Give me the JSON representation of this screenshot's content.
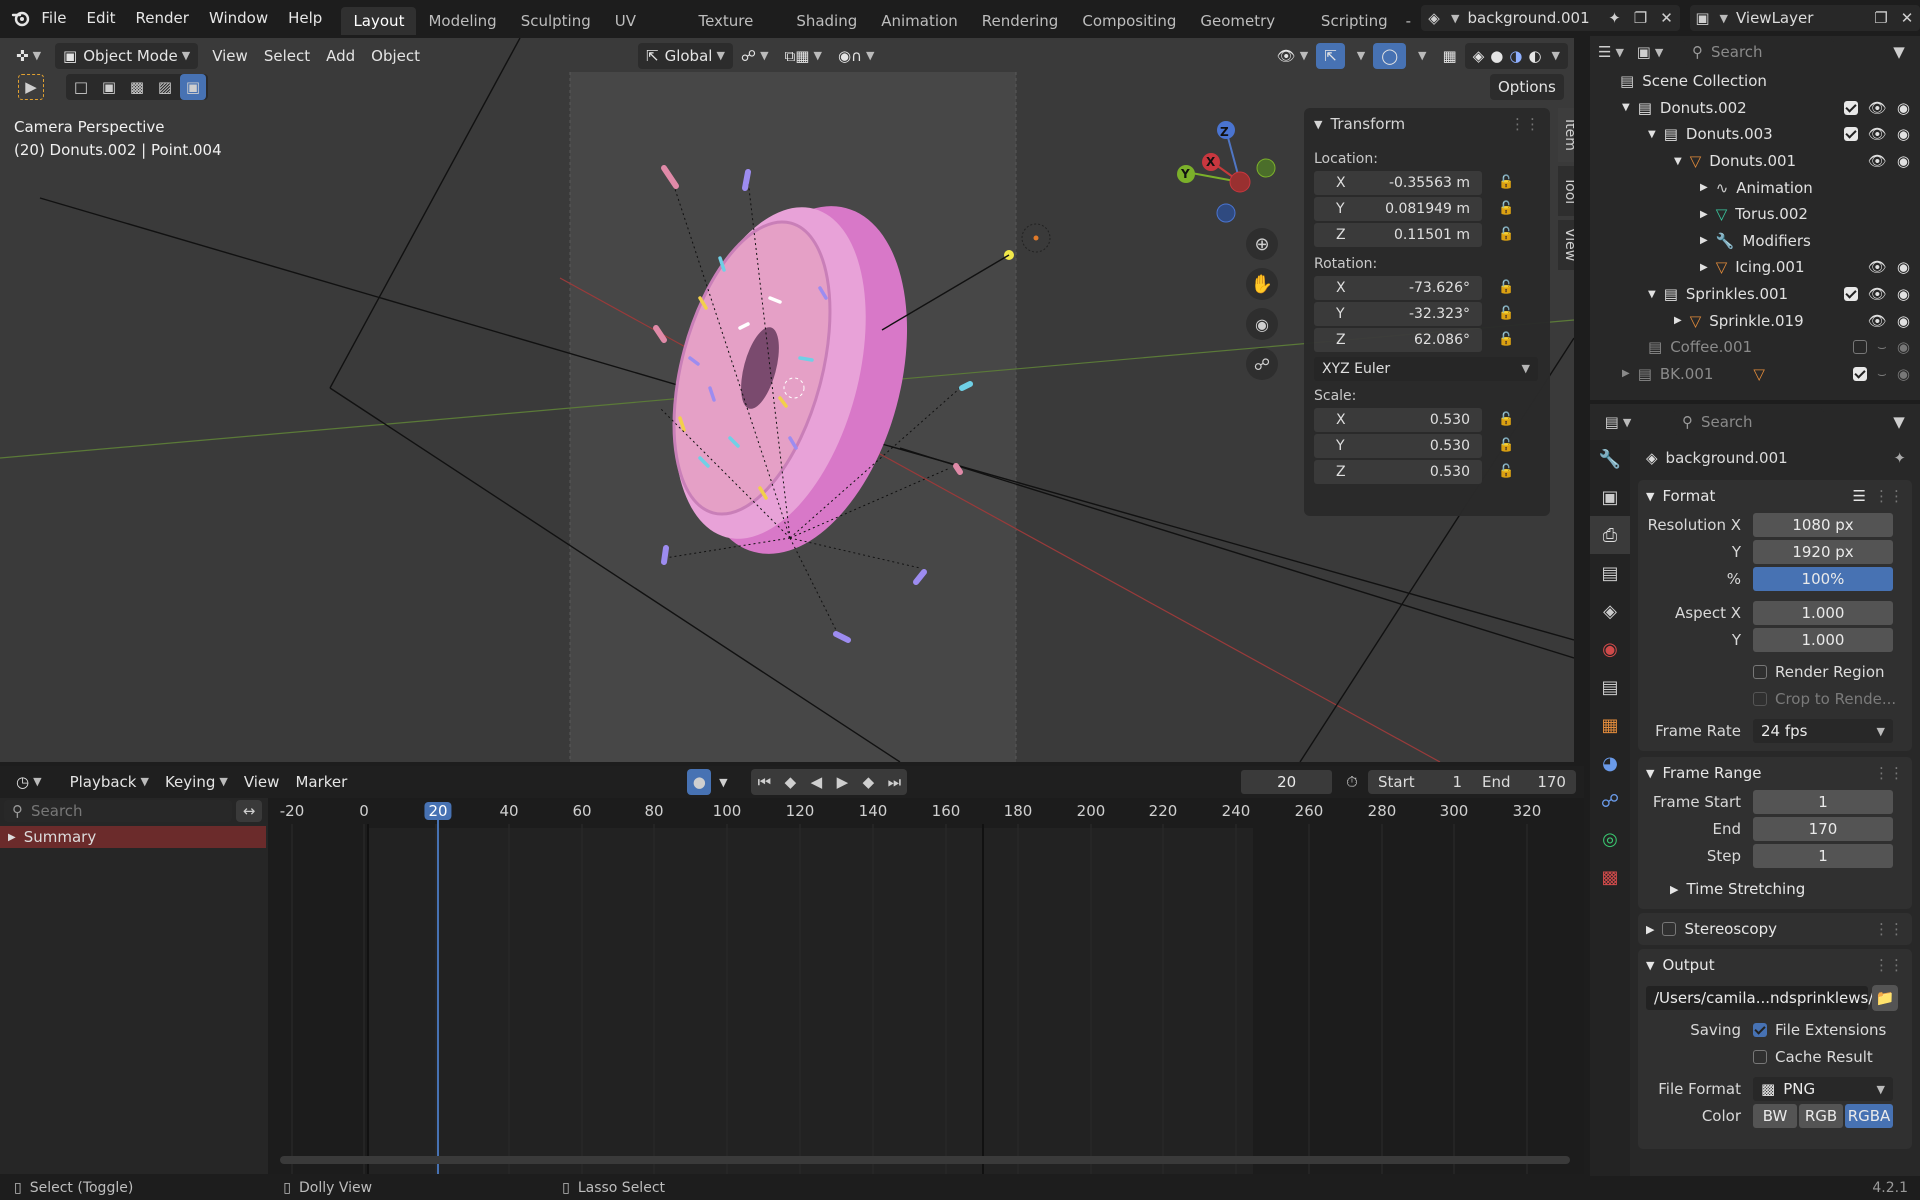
{
  "topbar": {
    "menus": [
      "File",
      "Edit",
      "Render",
      "Window",
      "Help"
    ],
    "workspaces": [
      "Layout",
      "Modeling",
      "Sculpting",
      "UV Editing",
      "Texture Paint",
      "Shading",
      "Animation",
      "Rendering",
      "Compositing",
      "Geometry Nodes",
      "Scripting"
    ],
    "active_workspace": "Layout",
    "more": "-",
    "scene_name": "background.001",
    "view_layer": "ViewLayer"
  },
  "viewport": {
    "mode": "Object Mode",
    "menus": [
      "View",
      "Select",
      "Add",
      "Object"
    ],
    "orientation": "Global",
    "options": "Options",
    "overlay_title": "Camera Perspective",
    "overlay_subtitle": "(20) Donuts.002 | Point.004",
    "sidetabs": [
      "Item",
      "Tool",
      "View"
    ],
    "gizmo": {
      "z": "Z",
      "y": "Y",
      "x": "X"
    }
  },
  "transform": {
    "title": "Transform",
    "location_label": "Location:",
    "location": [
      {
        "axis": "X",
        "value": "-0.35563 m"
      },
      {
        "axis": "Y",
        "value": "0.081949 m"
      },
      {
        "axis": "Z",
        "value": "0.11501 m"
      }
    ],
    "rotation_label": "Rotation:",
    "rotation": [
      {
        "axis": "X",
        "value": "-73.626°"
      },
      {
        "axis": "Y",
        "value": "-32.323°"
      },
      {
        "axis": "Z",
        "value": "62.086°"
      }
    ],
    "rotation_mode": "XYZ Euler",
    "scale_label": "Scale:",
    "scale": [
      {
        "axis": "X",
        "value": "0.530"
      },
      {
        "axis": "Y",
        "value": "0.530"
      },
      {
        "axis": "Z",
        "value": "0.530"
      }
    ]
  },
  "outliner": {
    "search_placeholder": "Search",
    "items": [
      {
        "label": "Scene Collection"
      },
      {
        "label": "Donuts.002"
      },
      {
        "label": "Donuts.003"
      },
      {
        "label": "Donuts.001"
      },
      {
        "label": "Animation"
      },
      {
        "label": "Torus.002"
      },
      {
        "label": "Modifiers"
      },
      {
        "label": "Icing.001"
      },
      {
        "label": "Sprinkles.001"
      },
      {
        "label": "Sprinkle.019"
      },
      {
        "label": "Coffee.001"
      },
      {
        "label": "BK.001"
      }
    ]
  },
  "properties": {
    "search_placeholder": "Search",
    "object_name": "background.001",
    "format": {
      "title": "Format",
      "res_x_label": "Resolution X",
      "res_x": "1080 px",
      "res_y_label": "Y",
      "res_y": "1920 px",
      "pct_label": "%",
      "pct": "100%",
      "aspect_x_label": "Aspect X",
      "aspect_x": "1.000",
      "aspect_y_label": "Y",
      "aspect_y": "1.000",
      "render_region": "Render Region",
      "crop": "Crop to Rende...",
      "frame_rate_label": "Frame Rate",
      "frame_rate": "24 fps"
    },
    "frame_range": {
      "title": "Frame Range",
      "start_label": "Frame Start",
      "start": "1",
      "end_label": "End",
      "end": "170",
      "step_label": "Step",
      "step": "1",
      "time_stretching": "Time Stretching"
    },
    "stereoscopy": "Stereoscopy",
    "output": {
      "title": "Output",
      "path": "/Users/camila...ndsprinklews/",
      "saving_label": "Saving",
      "file_extensions": "File Extensions",
      "cache_result": "Cache Result",
      "file_format_label": "File Format",
      "file_format": "PNG",
      "color_label": "Color",
      "color_modes": [
        "BW",
        "RGB",
        "RGBA"
      ]
    }
  },
  "timeline": {
    "menus": [
      "Playback",
      "Keying",
      "View",
      "Marker"
    ],
    "current_frame": "20",
    "start_label": "Start",
    "start": "1",
    "end_label": "End",
    "end": "170",
    "search_placeholder": "Search",
    "summary": "Summary",
    "ruler": [
      "-20",
      "0",
      "20",
      "40",
      "60",
      "80",
      "100",
      "120",
      "140",
      "160",
      "180",
      "200",
      "220",
      "240",
      "260",
      "280",
      "300",
      "320"
    ]
  },
  "statusbar": {
    "select": "Select (Toggle)",
    "dolly": "Dolly View",
    "lasso": "Lasso Select",
    "version": "4.2.1"
  },
  "colors": {
    "accent_blue": "#4772b3",
    "summary_red": "#6b2b2b",
    "donut_pink": "#e88ad8"
  }
}
